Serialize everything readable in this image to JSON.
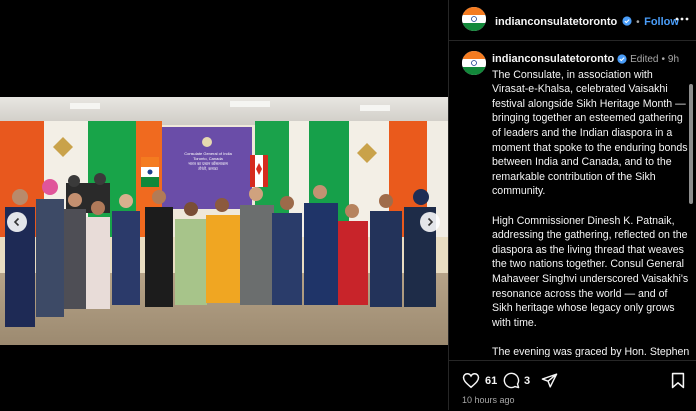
{
  "post": {
    "username": "indianconsulatetoronto",
    "follow_label": "Follow",
    "edited_label": "Edited",
    "age": "9h",
    "caption": [
      "The Consulate, in association with Virasat-e-Khalsa, celebrated Vaisakhi festival alongside Sikh Heritage Month — bringing together an esteemed gathering of leaders and the Indian diaspora in a moment that spoke to the enduring bonds between India and Canada, and to the remarkable contribution of the Sikh community.",
      "High Commissioner Dinesh K. Patnaik, addressing the gathering, reflected on the diaspora as the living thread that weaves the two nations together. Consul General Mahaveer Singhvi underscored Vaisakhi's resonance across the world — and of Sikh heritage whose legacy only grows with time.",
      "The evening was graced by Hon. Stephen Lecce, Ontario's Minister of Energy & Mines, Hon. Nina Tangri,"
    ],
    "likes": "61",
    "comments": "3",
    "timestamp": "10 hours ago"
  },
  "banner": {
    "line1": "Consulate General of India",
    "line2": "Toronto, Canada",
    "line3": "भारत का प्रधान कोंसलावास",
    "line4": "टोरंटो, कनाडा"
  },
  "icons": {
    "verified": "verified-badge-icon",
    "more": "more-options-icon",
    "like": "heart-icon",
    "comment": "comment-bubble-icon",
    "share": "share-send-icon",
    "save": "bookmark-icon",
    "prev": "chevron-left-icon",
    "next": "chevron-right-icon"
  },
  "colors": {
    "link_blue": "#4a9df8",
    "banner_purple": "#6a4da8",
    "saffron": "#f26b1d",
    "green": "#1aa24b"
  }
}
